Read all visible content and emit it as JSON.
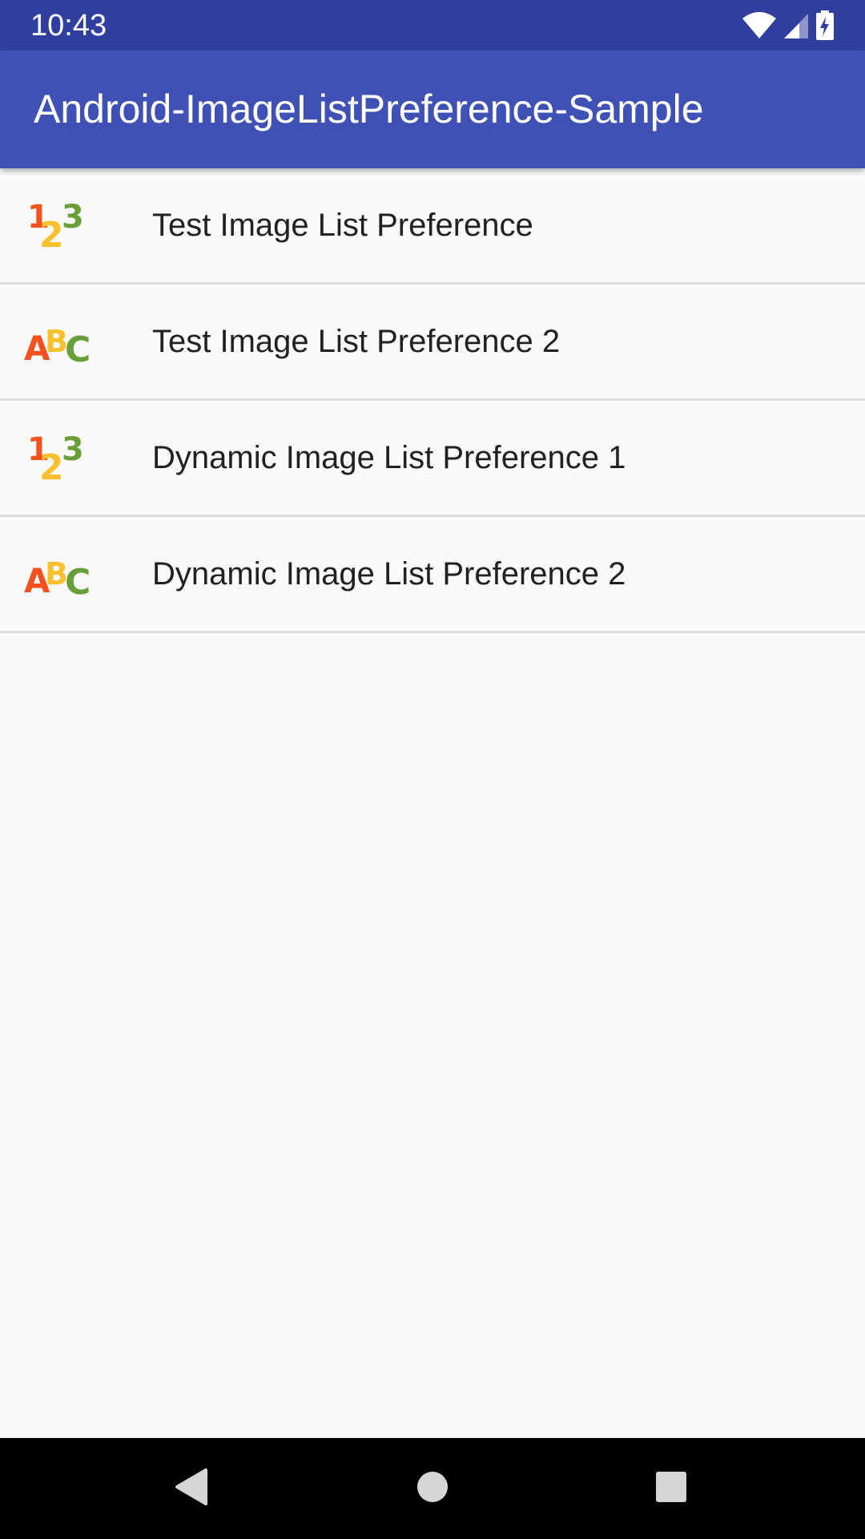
{
  "status_bar": {
    "time": "10:43",
    "icons": [
      "wifi-icon",
      "cell-signal-icon",
      "battery-charging-icon"
    ]
  },
  "app_bar": {
    "title": "Android-ImageListPreference-Sample",
    "color": "#3f51b5"
  },
  "preferences": [
    {
      "title": "Test Image List Preference",
      "icon": "numbers-123-icon"
    },
    {
      "title": "Test Image List Preference 2",
      "icon": "letters-abc-icon"
    },
    {
      "title": "Dynamic Image List Preference 1",
      "icon": "numbers-123-icon"
    },
    {
      "title": "Dynamic Image List Preference 2",
      "icon": "letters-abc-icon"
    }
  ],
  "nav_bar": {
    "buttons": [
      "back-icon",
      "home-icon",
      "recents-icon"
    ]
  },
  "colors": {
    "status_bar": "#303f9f",
    "primary": "#3f51b5",
    "background": "#fafafa",
    "text": "#212121",
    "icon_red": "#f4511e",
    "icon_yellow": "#fbc02d",
    "icon_green": "#689f38"
  }
}
